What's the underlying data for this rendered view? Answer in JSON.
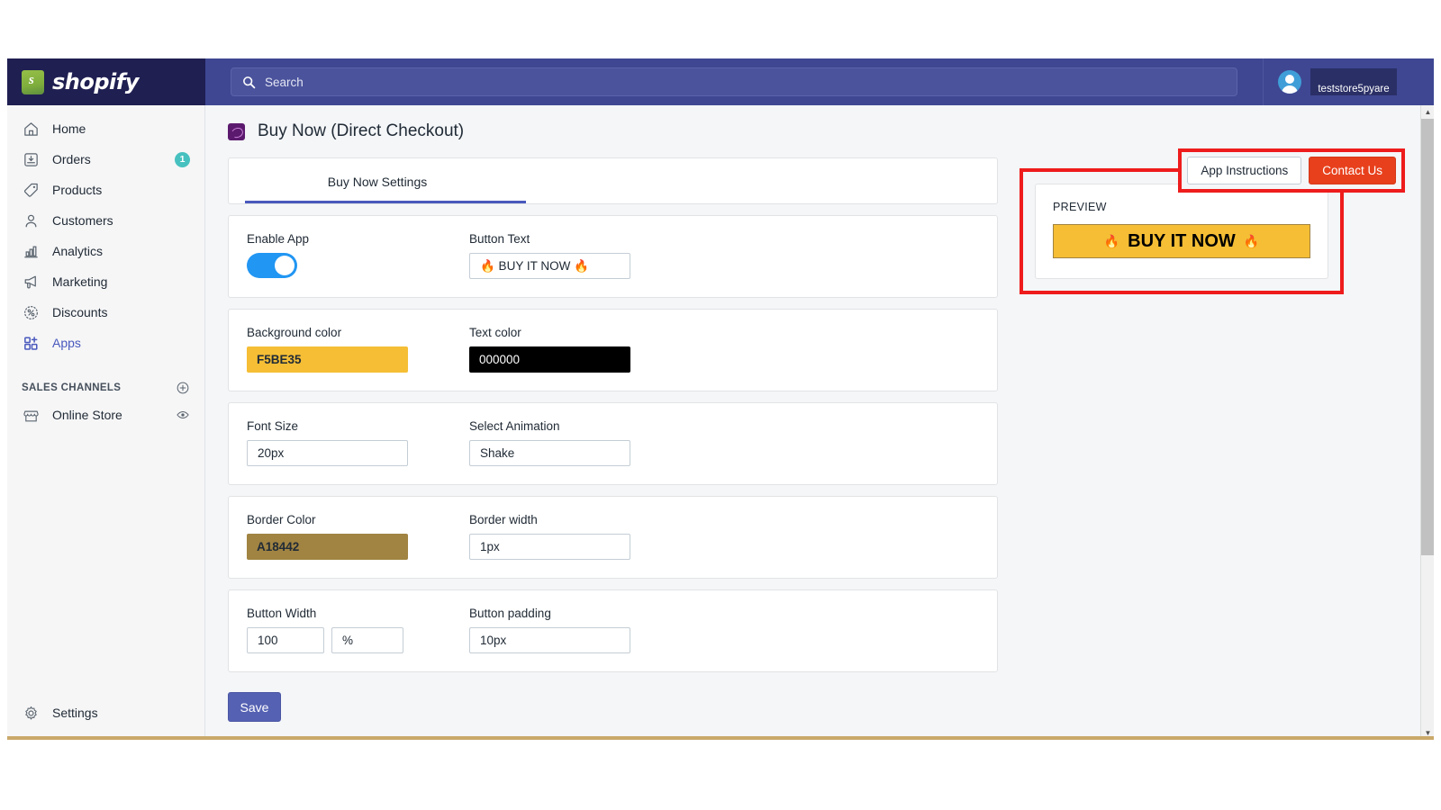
{
  "topbar": {
    "brand": "shopify",
    "search": {
      "placeholder": "Search",
      "icon": "search-icon"
    },
    "store_name": "teststore5pyare"
  },
  "sidebar": {
    "items": [
      {
        "label": "Home",
        "icon": "home-icon",
        "badge": "",
        "active": false
      },
      {
        "label": "Orders",
        "icon": "orders-icon",
        "badge": "1",
        "active": false
      },
      {
        "label": "Products",
        "icon": "tag-icon",
        "badge": "",
        "active": false
      },
      {
        "label": "Customers",
        "icon": "person-icon",
        "badge": "",
        "active": false
      },
      {
        "label": "Analytics",
        "icon": "bar-chart-icon",
        "badge": "",
        "active": false
      },
      {
        "label": "Marketing",
        "icon": "megaphone-icon",
        "badge": "",
        "active": false
      },
      {
        "label": "Discounts",
        "icon": "discount-icon",
        "badge": "",
        "active": false
      },
      {
        "label": "Apps",
        "icon": "apps-icon",
        "badge": "",
        "active": true
      }
    ],
    "sales_channels": {
      "title": "SALES CHANNELS",
      "add_icon": "plus-circle-icon",
      "items": [
        {
          "label": "Online Store",
          "icon": "storefront-icon",
          "trailing_icon": "eye-icon"
        }
      ]
    },
    "settings": {
      "label": "Settings",
      "icon": "gear-icon"
    }
  },
  "header": {
    "title": "Buy Now (Direct Checkout)",
    "app_icon": "app-logo-icon",
    "actions": {
      "app_instructions": "App Instructions",
      "contact_us": "Contact Us"
    }
  },
  "tabs": [
    {
      "label": "Buy Now Settings",
      "active": true
    }
  ],
  "form": {
    "enable_app": {
      "label": "Enable App",
      "value": "on"
    },
    "button_text": {
      "label": "Button Text",
      "value": "🔥 BUY IT NOW 🔥"
    },
    "background_color": {
      "label": "Background color",
      "value": "F5BE35",
      "swatch": "#F5BE35"
    },
    "text_color": {
      "label": "Text color",
      "value": "000000",
      "swatch": "#000000"
    },
    "font_size": {
      "label": "Font Size",
      "value": "20px"
    },
    "select_animation": {
      "label": "Select Animation",
      "value": "Shake"
    },
    "border_color": {
      "label": "Border Color",
      "value": "A18442",
      "swatch": "#A18442"
    },
    "border_width": {
      "label": "Border width",
      "value": "1px"
    },
    "button_width": {
      "label": "Button Width",
      "value": "100",
      "unit": "%"
    },
    "button_padding": {
      "label": "Button padding",
      "value": "10px"
    },
    "save_label": "Save"
  },
  "preview": {
    "label": "PREVIEW",
    "button_text": "BUY IT NOW",
    "left_emoji": "🔥",
    "right_emoji": "🔥",
    "background": "#F5BE35",
    "text_color": "#000000",
    "border_color": "#A18442"
  },
  "annotations": {
    "highlight_color": "#EE1C1C"
  },
  "scrollbar": {
    "up": "▲",
    "down": "▼"
  }
}
